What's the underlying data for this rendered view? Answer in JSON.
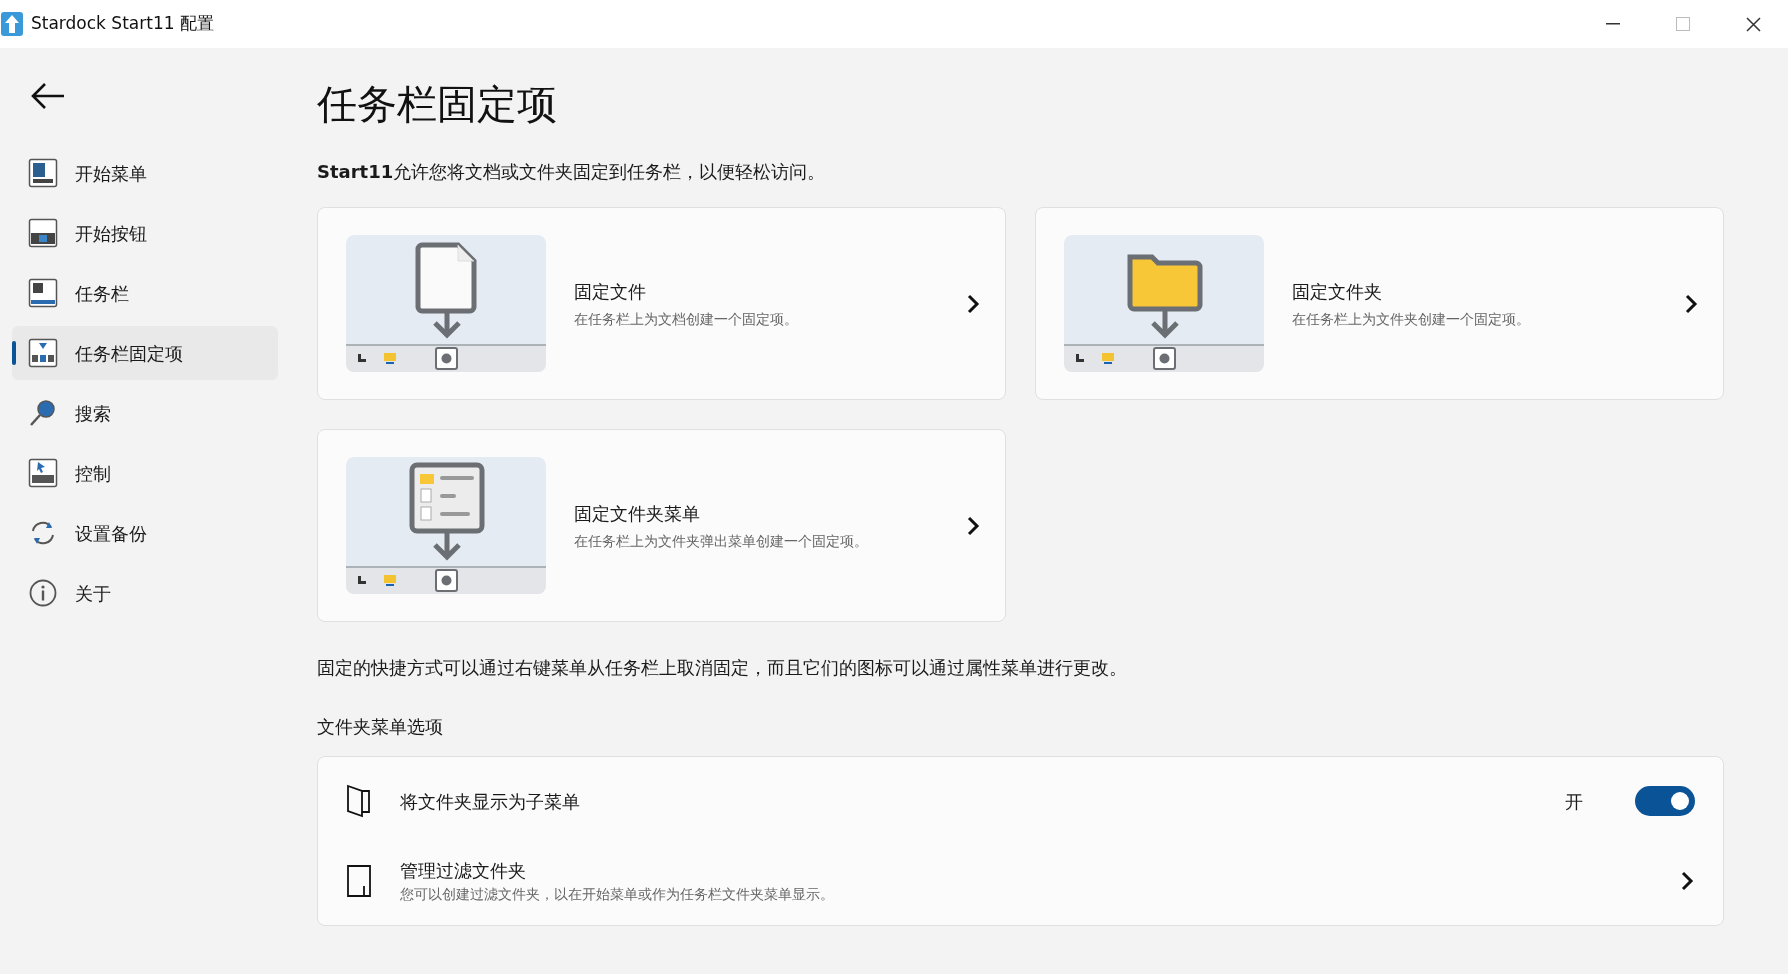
{
  "window": {
    "title": "Stardock Start11 配置"
  },
  "sidebar": {
    "items": [
      {
        "label": "开始菜单",
        "kind": "start-menu",
        "selected": false
      },
      {
        "label": "开始按钮",
        "kind": "start-button",
        "selected": false
      },
      {
        "label": "任务栏",
        "kind": "taskbar",
        "selected": false
      },
      {
        "label": "任务栏固定项",
        "kind": "taskbar-pins",
        "selected": true
      },
      {
        "label": "搜索",
        "kind": "search",
        "selected": false
      },
      {
        "label": "控制",
        "kind": "control",
        "selected": false
      },
      {
        "label": "设置备份",
        "kind": "backup",
        "selected": false
      },
      {
        "label": "关于",
        "kind": "about",
        "selected": false
      }
    ]
  },
  "page": {
    "title": "任务栏固定项",
    "intro": "**Start11**允许您将文档或文件夹固定到任务栏，以便轻松访问。",
    "cards": [
      {
        "kind": "file",
        "title": "固定文件",
        "description": "在任务栏上为文档创建一个固定项。"
      },
      {
        "kind": "folder",
        "title": "固定文件夹",
        "description": "在任务栏上为文件夹创建一个固定项。"
      },
      {
        "kind": "folder-menu",
        "title": "固定文件夹菜单",
        "description": "在任务栏上为文件夹弹出菜单创建一个固定项。"
      }
    ],
    "note": "固定的快捷方式可以通过右键菜单从任务栏上取消固定，而且它们的图标可以通过属性菜单进行更改。",
    "section_label": "文件夹菜单选项",
    "options": [
      {
        "kind": "toggle",
        "title": "将文件夹显示为子菜单",
        "state_label": "开",
        "on": true
      },
      {
        "kind": "link",
        "title": "管理过滤文件夹",
        "description": "您可以创建过滤文件夹，以在开始菜单或作为任务栏文件夹菜单显示。"
      }
    ]
  }
}
